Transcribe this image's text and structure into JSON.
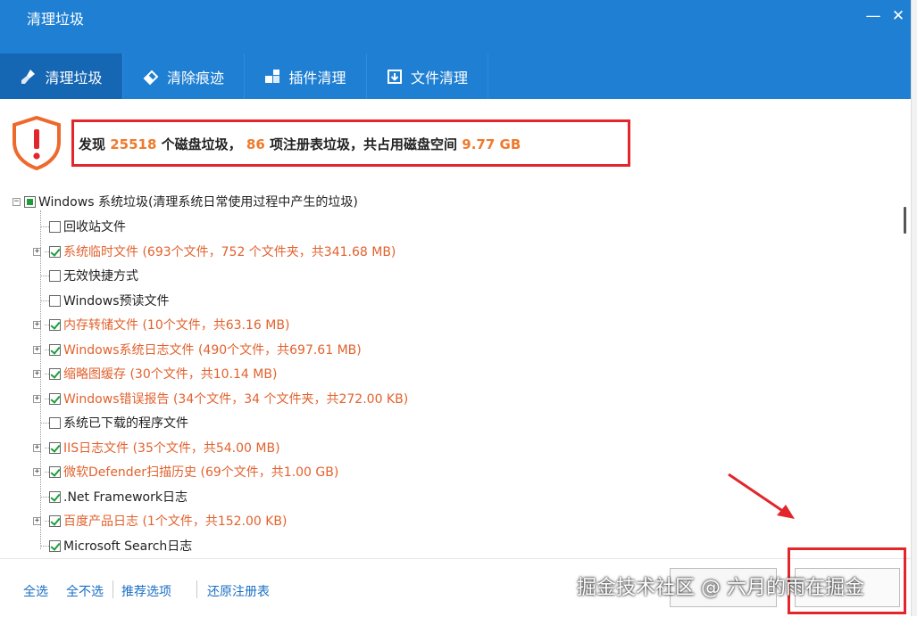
{
  "window": {
    "title": "清理垃圾",
    "minimize": "—",
    "close": "✕"
  },
  "tabs": [
    {
      "label": "清理垃圾",
      "icon": "broom-icon",
      "active": true
    },
    {
      "label": "清除痕迹",
      "icon": "eraser-icon",
      "active": false
    },
    {
      "label": "插件清理",
      "icon": "puzzle-icon",
      "active": false
    },
    {
      "label": "文件清理",
      "icon": "download-box-icon",
      "active": false
    }
  ],
  "summary": {
    "found": "发现",
    "disk_count": "25518",
    "disk_text": "个磁盘垃圾，",
    "reg_count": "86",
    "reg_text": "项注册表垃圾，共占用磁盘空间",
    "size": "9.77 GB"
  },
  "tree": {
    "root": {
      "label": "Windows 系统垃圾(清理系统日常使用过程中产生的垃圾)",
      "state": "partial"
    },
    "items": [
      {
        "label": "回收站文件",
        "checked": false,
        "expandable": false,
        "highlight": false
      },
      {
        "label": "系统临时文件 (693个文件，752 个文件夹，共341.68 MB)",
        "checked": true,
        "expandable": true,
        "highlight": true
      },
      {
        "label": "无效快捷方式",
        "checked": false,
        "expandable": false,
        "highlight": false
      },
      {
        "label": "Windows预读文件",
        "checked": false,
        "expandable": false,
        "highlight": false
      },
      {
        "label": "内存转储文件 (10个文件，共63.16 MB)",
        "checked": true,
        "expandable": true,
        "highlight": true
      },
      {
        "label": "Windows系统日志文件 (490个文件，共697.61 MB)",
        "checked": true,
        "expandable": true,
        "highlight": true
      },
      {
        "label": "缩略图缓存 (30个文件，共10.14 MB)",
        "checked": true,
        "expandable": true,
        "highlight": true
      },
      {
        "label": "Windows错误报告 (34个文件，34 个文件夹，共272.00 KB)",
        "checked": true,
        "expandable": true,
        "highlight": true
      },
      {
        "label": "系统已下载的程序文件",
        "checked": false,
        "expandable": false,
        "highlight": false
      },
      {
        "label": "IIS日志文件 (35个文件，共54.00 MB)",
        "checked": true,
        "expandable": true,
        "highlight": true
      },
      {
        "label": "微软Defender扫描历史 (69个文件，共1.00 GB)",
        "checked": true,
        "expandable": true,
        "highlight": true
      },
      {
        "label": ".Net Framework日志",
        "checked": true,
        "expandable": false,
        "highlight": false
      },
      {
        "label": "百度产品日志 (1个文件，共152.00 KB)",
        "checked": true,
        "expandable": true,
        "highlight": true
      },
      {
        "label": "Microsoft Search日志",
        "checked": true,
        "expandable": false,
        "highlight": false
      }
    ]
  },
  "bottom": {
    "select_all": "全选",
    "select_none": "全不选",
    "recommended": "推荐选项",
    "restore_registry": "还原注册表"
  },
  "watermark": "掘金技术社区 @ 六月的雨在掘金",
  "colors": {
    "titlebar": "#1f7fd3",
    "tab_active": "#1566b3",
    "highlight_text": "#e2622e",
    "number": "#ee7a2d",
    "annotation_red": "#e2262b",
    "check_green": "#1c9e3a"
  }
}
